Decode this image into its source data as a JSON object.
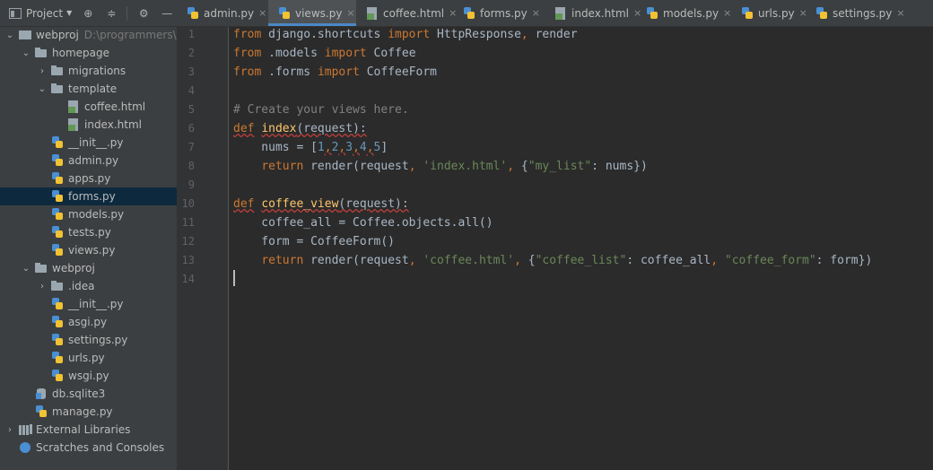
{
  "toolbar": {
    "project_label": "Project",
    "icons": [
      "target-icon",
      "collapse-icon",
      "gear-icon",
      "minimize-icon"
    ]
  },
  "tree": [
    {
      "label": "webproj",
      "hint": "D:\\programmers\\",
      "icon": "project",
      "depth": 0,
      "arrow": "down"
    },
    {
      "label": "homepage",
      "icon": "folder",
      "depth": 1,
      "arrow": "down"
    },
    {
      "label": "migrations",
      "icon": "folder",
      "depth": 2,
      "arrow": "right"
    },
    {
      "label": "template",
      "icon": "folder",
      "depth": 2,
      "arrow": "down"
    },
    {
      "label": "coffee.html",
      "icon": "html",
      "depth": 3
    },
    {
      "label": "index.html",
      "icon": "html",
      "depth": 3
    },
    {
      "label": "__init__.py",
      "icon": "python",
      "depth": 2
    },
    {
      "label": "admin.py",
      "icon": "python",
      "depth": 2
    },
    {
      "label": "apps.py",
      "icon": "python",
      "depth": 2
    },
    {
      "label": "forms.py",
      "icon": "python",
      "depth": 2,
      "selected": true
    },
    {
      "label": "models.py",
      "icon": "python",
      "depth": 2
    },
    {
      "label": "tests.py",
      "icon": "python",
      "depth": 2
    },
    {
      "label": "views.py",
      "icon": "python",
      "depth": 2
    },
    {
      "label": "webproj",
      "icon": "folder",
      "depth": 1,
      "arrow": "down"
    },
    {
      "label": ".idea",
      "icon": "folder",
      "depth": 2,
      "arrow": "right"
    },
    {
      "label": "__init__.py",
      "icon": "python",
      "depth": 2
    },
    {
      "label": "asgi.py",
      "icon": "python",
      "depth": 2
    },
    {
      "label": "settings.py",
      "icon": "python",
      "depth": 2
    },
    {
      "label": "urls.py",
      "icon": "python",
      "depth": 2
    },
    {
      "label": "wsgi.py",
      "icon": "python",
      "depth": 2
    },
    {
      "label": "db.sqlite3",
      "icon": "database",
      "depth": 1
    },
    {
      "label": "manage.py",
      "icon": "python",
      "depth": 1
    },
    {
      "label": "External Libraries",
      "icon": "library",
      "depth": 0,
      "arrow": "right"
    },
    {
      "label": "Scratches and Consoles",
      "icon": "scratch",
      "depth": 0,
      "arrow": "none"
    }
  ],
  "tabs": [
    {
      "label": "admin.py",
      "icon": "python",
      "close": "×"
    },
    {
      "label": "views.py",
      "icon": "python",
      "close": "×",
      "active": true
    },
    {
      "label": "coffee.html",
      "icon": "html",
      "close": "×"
    },
    {
      "label": "forms.py",
      "icon": "python",
      "close": "×"
    },
    {
      "label": "index.html",
      "icon": "html",
      "close": "×"
    },
    {
      "label": "models.py",
      "icon": "python",
      "close": "×"
    },
    {
      "label": "urls.py",
      "icon": "python",
      "close": "×"
    },
    {
      "label": "settings.py",
      "icon": "python",
      "close": "×"
    }
  ],
  "editor": {
    "line_numbers": [
      "1",
      "2",
      "3",
      "4",
      "5",
      "6",
      "7",
      "8",
      "9",
      "10",
      "11",
      "12",
      "13",
      "14"
    ],
    "lines": [
      [
        {
          "t": "from",
          "c": "kw"
        },
        {
          "t": " django.shortcuts ",
          "c": ""
        },
        {
          "t": "import",
          "c": "kw"
        },
        {
          "t": " HttpResponse",
          "c": ""
        },
        {
          "t": ", ",
          "c": "kw"
        },
        {
          "t": "render",
          "c": ""
        }
      ],
      [
        {
          "t": "from",
          "c": "kw"
        },
        {
          "t": " .models ",
          "c": ""
        },
        {
          "t": "import",
          "c": "kw"
        },
        {
          "t": " Coffee",
          "c": ""
        }
      ],
      [
        {
          "t": "from",
          "c": "kw"
        },
        {
          "t": " .forms ",
          "c": ""
        },
        {
          "t": "import",
          "c": "kw"
        },
        {
          "t": " CoffeeForm",
          "c": ""
        }
      ],
      [],
      [
        {
          "t": "# Create your views here.",
          "c": "cm"
        }
      ],
      [
        {
          "t": "def",
          "c": "kw wavy"
        },
        {
          "t": " ",
          "c": ""
        },
        {
          "t": "index",
          "c": "fn wavy"
        },
        {
          "t": "(request):",
          "c": "wavy"
        }
      ],
      [
        {
          "t": "    nums = [",
          "c": ""
        },
        {
          "t": "1",
          "c": "num"
        },
        {
          "t": ",",
          "c": "kw wavy"
        },
        {
          "t": "2",
          "c": "num"
        },
        {
          "t": ",",
          "c": "kw wavy"
        },
        {
          "t": "3",
          "c": "num"
        },
        {
          "t": ",",
          "c": "kw wavy"
        },
        {
          "t": "4",
          "c": "num"
        },
        {
          "t": ",",
          "c": "kw wavy"
        },
        {
          "t": "5",
          "c": "num"
        },
        {
          "t": "]",
          "c": ""
        }
      ],
      [
        {
          "t": "    ",
          "c": ""
        },
        {
          "t": "return",
          "c": "kw"
        },
        {
          "t": " render(request",
          "c": ""
        },
        {
          "t": ", ",
          "c": "kw"
        },
        {
          "t": "'index.html'",
          "c": "str"
        },
        {
          "t": ", ",
          "c": "kw"
        },
        {
          "t": "{",
          "c": ""
        },
        {
          "t": "\"my_list\"",
          "c": "str"
        },
        {
          "t": ": nums})",
          "c": ""
        }
      ],
      [],
      [
        {
          "t": "def",
          "c": "kw wavy"
        },
        {
          "t": " ",
          "c": ""
        },
        {
          "t": "coffee_view",
          "c": "fn wavy"
        },
        {
          "t": "(request):",
          "c": "wavy"
        }
      ],
      [
        {
          "t": "    coffee_all = Coffee.objects.all()",
          "c": ""
        }
      ],
      [
        {
          "t": "    form = CoffeeForm()",
          "c": ""
        }
      ],
      [
        {
          "t": "    ",
          "c": ""
        },
        {
          "t": "return",
          "c": "kw"
        },
        {
          "t": " render(request",
          "c": ""
        },
        {
          "t": ", ",
          "c": "kw"
        },
        {
          "t": "'coffee.html'",
          "c": "str"
        },
        {
          "t": ", ",
          "c": "kw"
        },
        {
          "t": "{",
          "c": ""
        },
        {
          "t": "\"coffee_list\"",
          "c": "str"
        },
        {
          "t": ": coffee_all",
          "c": ""
        },
        {
          "t": ", ",
          "c": "kw"
        },
        {
          "t": "\"coffee_form\"",
          "c": "str"
        },
        {
          "t": ": form})",
          "c": ""
        }
      ],
      []
    ]
  }
}
